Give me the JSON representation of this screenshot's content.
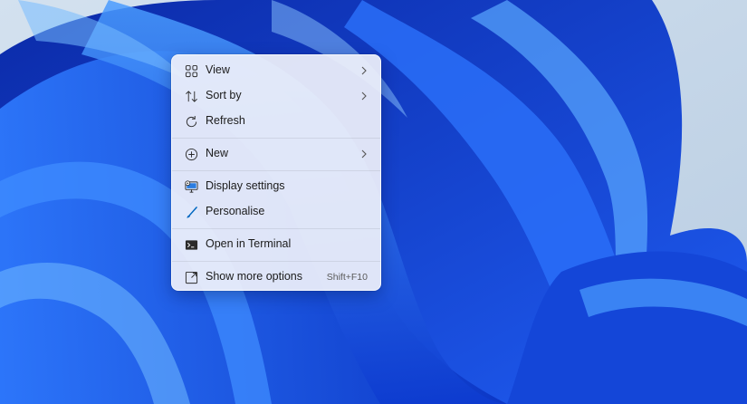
{
  "context_menu": {
    "items": [
      {
        "label": "View",
        "icon": "view-grid-icon",
        "submenu": true
      },
      {
        "label": "Sort by",
        "icon": "sort-icon",
        "submenu": true
      },
      {
        "label": "Refresh",
        "icon": "refresh-icon",
        "submenu": false
      },
      {
        "label": "New",
        "icon": "new-plus-icon",
        "submenu": true
      },
      {
        "label": "Display settings",
        "icon": "display-settings-icon",
        "submenu": false
      },
      {
        "label": "Personalise",
        "icon": "brush-icon",
        "submenu": false
      },
      {
        "label": "Open in Terminal",
        "icon": "terminal-icon",
        "submenu": false
      },
      {
        "label": "Show more options",
        "icon": "more-options-icon",
        "shortcut": "Shift+F10",
        "submenu": false
      }
    ]
  },
  "colors": {
    "wallpaper_dark": "#0a2fc4",
    "wallpaper_mid": "#1c5ef0",
    "wallpaper_light": "#5aa8ff",
    "wallpaper_bg": "#c9d9ea",
    "accent_blue": "#0067c0"
  }
}
